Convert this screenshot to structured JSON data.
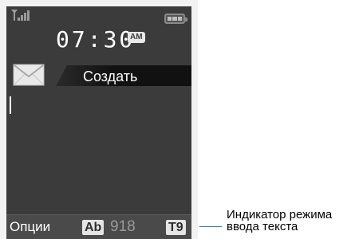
{
  "status": {
    "signal_icon": "signal-strength-icon",
    "battery_icon": "battery-icon",
    "time": "07:30",
    "ampm": "AM"
  },
  "header": {
    "icon": "envelope-icon",
    "title": "Создать"
  },
  "softkeys": {
    "left_label": "Опции",
    "input_mode_primary": "Ab",
    "char_counter": "918",
    "input_mode_t9": "T9"
  },
  "callout": {
    "line1": "Индикатор режима",
    "line2": "ввода текста"
  },
  "colors": {
    "screen_bg": "#3b3b3b",
    "text": "#ffffff",
    "callout_line": "#2c7fb8"
  }
}
